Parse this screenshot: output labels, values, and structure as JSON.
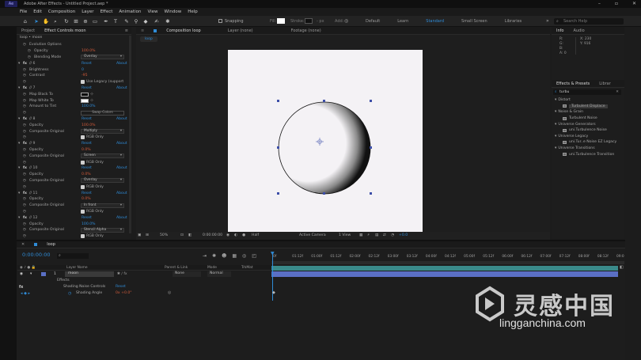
{
  "window": {
    "title": "Adobe After Effects - Untitled Project.aep *"
  },
  "menu": [
    "File",
    "Edit",
    "Composition",
    "Layer",
    "Effect",
    "Animation",
    "View",
    "Window",
    "Help"
  ],
  "toolbar": {
    "snapping": "Snapping",
    "fill": "Fill:",
    "stroke": "Stroke:",
    "stroke_px": "- px",
    "add": "Add:",
    "workspaces": [
      "Default",
      "Learn",
      "Standard",
      "Small Screen",
      "Libraries"
    ],
    "active_workspace": "Standard",
    "search_placeholder": "Search Help"
  },
  "left_panel": {
    "tabs": [
      "Project",
      "Effect Controls moon"
    ],
    "breadcrumb": "loop • moon",
    "rows": [
      {
        "kind": "label",
        "indent": 1,
        "label": "Evolution Options"
      },
      {
        "kind": "value",
        "indent": 2,
        "label": "Opacity",
        "value": "100.0%",
        "color": "red"
      },
      {
        "kind": "dropdown",
        "indent": 2,
        "label": "Blending Mode",
        "value": "Overlay"
      },
      {
        "kind": "fx",
        "label": "// 6",
        "reset": "Reset",
        "about": "About"
      },
      {
        "kind": "value",
        "indent": 1,
        "label": "Brightness",
        "value": "0",
        "color": "blue"
      },
      {
        "kind": "value",
        "indent": 1,
        "label": "Contrast",
        "value": "-95",
        "color": "red"
      },
      {
        "kind": "check",
        "indent": 1,
        "label": "",
        "value": "Use Legacy (support"
      },
      {
        "kind": "fx",
        "label": "// 7",
        "reset": "Reset",
        "about": "About"
      },
      {
        "kind": "swatch",
        "indent": 1,
        "label": "Map Black To",
        "swatch": "black"
      },
      {
        "kind": "swatch",
        "indent": 1,
        "label": "Map White To",
        "swatch": "white"
      },
      {
        "kind": "value",
        "indent": 1,
        "label": "Amount to Tint",
        "value": "100.0%",
        "color": "blue"
      },
      {
        "kind": "button",
        "indent": 1,
        "label": "",
        "value": "Swap Colors"
      },
      {
        "kind": "fx",
        "label": "// 8",
        "reset": "Reset",
        "about": "About"
      },
      {
        "kind": "value",
        "indent": 1,
        "label": "Opacity",
        "value": "100.0%",
        "color": "red"
      },
      {
        "kind": "dropdown",
        "indent": 1,
        "label": "Composite Original",
        "value": "Multiply"
      },
      {
        "kind": "check",
        "indent": 1,
        "label": "",
        "value": "RGB Only"
      },
      {
        "kind": "fx",
        "label": "// 9",
        "reset": "Reset",
        "about": "About"
      },
      {
        "kind": "value",
        "indent": 1,
        "label": "Opacity",
        "value": "0.0%",
        "color": "red"
      },
      {
        "kind": "dropdown",
        "indent": 1,
        "label": "Composite Original",
        "value": "Screen"
      },
      {
        "kind": "check",
        "indent": 1,
        "label": "",
        "value": "RGB Only"
      },
      {
        "kind": "fx",
        "label": "// 10",
        "reset": "Reset",
        "about": "About"
      },
      {
        "kind": "value",
        "indent": 1,
        "label": "Opacity",
        "value": "0.0%",
        "color": "red"
      },
      {
        "kind": "dropdown",
        "indent": 1,
        "label": "Composite Original",
        "value": "Overlay"
      },
      {
        "kind": "check",
        "indent": 1,
        "label": "",
        "value": "RGB Only"
      },
      {
        "kind": "fx",
        "label": "// 11",
        "reset": "Reset",
        "about": "About"
      },
      {
        "kind": "value",
        "indent": 1,
        "label": "Opacity",
        "value": "0.0%",
        "color": "red"
      },
      {
        "kind": "dropdown",
        "indent": 1,
        "label": "Composite Original",
        "value": "In front"
      },
      {
        "kind": "check",
        "indent": 1,
        "label": "",
        "value": "RGB Only"
      },
      {
        "kind": "fx",
        "label": "// 12",
        "reset": "Reset",
        "about": "About"
      },
      {
        "kind": "value",
        "indent": 1,
        "label": "Opacity",
        "value": "100.0%",
        "color": "blue"
      },
      {
        "kind": "dropdown",
        "indent": 1,
        "label": "Composite Original",
        "value": "Stencil Alpha"
      },
      {
        "kind": "check",
        "indent": 1,
        "label": "",
        "value": "RGB Only"
      }
    ]
  },
  "comp_panel": {
    "tabs": [
      "Composition loop",
      "Layer (none)",
      "Footage (none)"
    ],
    "subtab": "loop",
    "footer": {
      "zoom": "50%",
      "time": "0:00:00:00",
      "resolution": "Half",
      "camera": "Active Camera",
      "view": "1 View",
      "exposure": "+0.0"
    }
  },
  "right_panel": {
    "info_tabs": [
      "Info",
      "Audio"
    ],
    "info": {
      "r": "R:",
      "g": "G:",
      "b": "B:",
      "a": "A:",
      "x": "X: 230",
      "y": "Y: 916",
      "a_val": "0"
    },
    "effects_tabs": [
      "Effects & Presets",
      "Librar"
    ],
    "search_value": "turbu",
    "items": [
      {
        "type": "category",
        "label": "Distort"
      },
      {
        "type": "effect",
        "label": "Turbulent Displace",
        "selected": true
      },
      {
        "type": "category",
        "label": "Noise & Grain"
      },
      {
        "type": "effect",
        "label": "Turbulent Noise"
      },
      {
        "type": "category",
        "label": "Universe Generators"
      },
      {
        "type": "effect",
        "label": "uni.Turbulence Noise"
      },
      {
        "type": "category",
        "label": "Universe Legacy"
      },
      {
        "type": "effect",
        "label": "uni.Tur..e Noise EZ Legacy"
      },
      {
        "type": "category",
        "label": "Universe Transitions"
      },
      {
        "type": "effect",
        "label": "uni.Turbulence Transition"
      }
    ]
  },
  "timeline": {
    "tab": "loop",
    "timecode": "0:00:00:00",
    "columns": {
      "layer_name": "Layer Name",
      "parent": "Parent & Link",
      "mode": "Mode",
      "trkmat": "TrkMat"
    },
    "layer": {
      "number": "1",
      "name": "moon",
      "parent": "None",
      "mode": "Normal"
    },
    "effects_label": "Effects",
    "effect_name": "Shading Noise Controls",
    "effect_reset": "Reset",
    "property": "Shading Angle",
    "property_value": "0x +0.0°",
    "ruler": [
      "0f",
      "01:12f",
      "01:00f",
      "01:12f",
      "02:00f",
      "02:12f",
      "03:00f",
      "03:12f",
      "04:00f",
      "04:12f",
      "05:00f",
      "05:12f",
      "06:00f",
      "06:12f",
      "07:00f",
      "07:12f",
      "08:00f",
      "08:12f",
      "09:0"
    ]
  },
  "watermark": {
    "cn": "灵感中国",
    "en": "lingganchina.com"
  },
  "colors": {
    "accent": "#2f8bd6",
    "keyed": "#d05a3a",
    "layer_bar": "#5a6fc4",
    "audio_bar": "#3a8a8a"
  }
}
